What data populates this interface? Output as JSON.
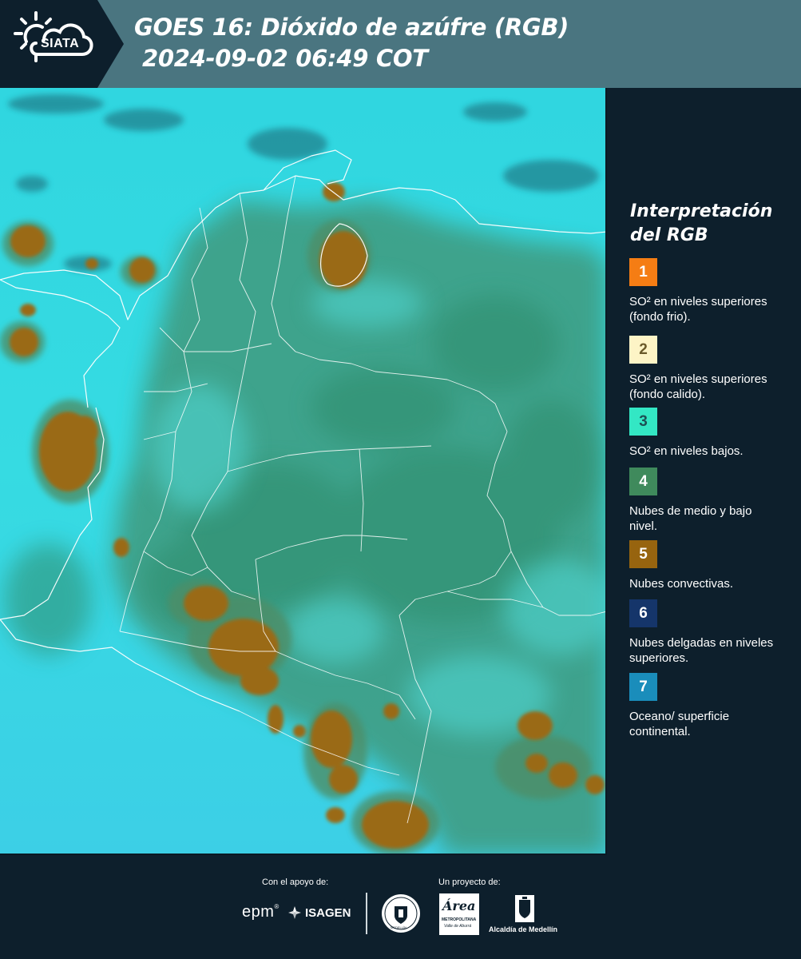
{
  "header": {
    "logo_text": "SIATA",
    "title_line1": "GOES 16: Dióxido de azúfre (RGB)",
    "title_line2": "2024-09-02 06:49 COT"
  },
  "legend": {
    "title": "Interpretación del RGB",
    "items": [
      {
        "number": "1",
        "color": "#f57d14",
        "text_color": "#ffffff",
        "description": "SO² en niveles superiores (fondo frio)."
      },
      {
        "number": "2",
        "color": "#fdf4c6",
        "text_color": "#6a5a2a",
        "description": "SO² en niveles superiores (fondo calido)."
      },
      {
        "number": "3",
        "color": "#33e7c4",
        "text_color": "#1d4f54",
        "description": "SO² en niveles bajos."
      },
      {
        "number": "4",
        "color": "#3f8a5c",
        "text_color": "#ffffff",
        "description": "Nubes de medio y bajo nivel."
      },
      {
        "number": "5",
        "color": "#97640f",
        "text_color": "#ffffff",
        "description": "Nubes convectivas."
      },
      {
        "number": "6",
        "color": "#15356a",
        "text_color": "#ffffff",
        "description": "Nubes delgadas en niveles superiores."
      },
      {
        "number": "7",
        "color": "#1a8dbb",
        "text_color": "#ffffff",
        "description": "Oceano/ superficie continental."
      }
    ]
  },
  "footer": {
    "support_label": "Con el apoyo de:",
    "project_label": "Un proyecto de:",
    "sponsor_epm": "epm",
    "sponsor_isagen": "ISAGEN",
    "area_line1": "Área",
    "area_line2": "METROPOLITANA",
    "area_line3": "Valle de Aburrá",
    "alcaldia": "Alcaldía de Medellín",
    "seal_text": "MEDELLÍN"
  },
  "colors": {
    "background": "#0d1f2c",
    "header": "#4a7580",
    "ocean": "#36d8e0",
    "vegetation": "#3f9a7e",
    "convective": "#97640f"
  }
}
